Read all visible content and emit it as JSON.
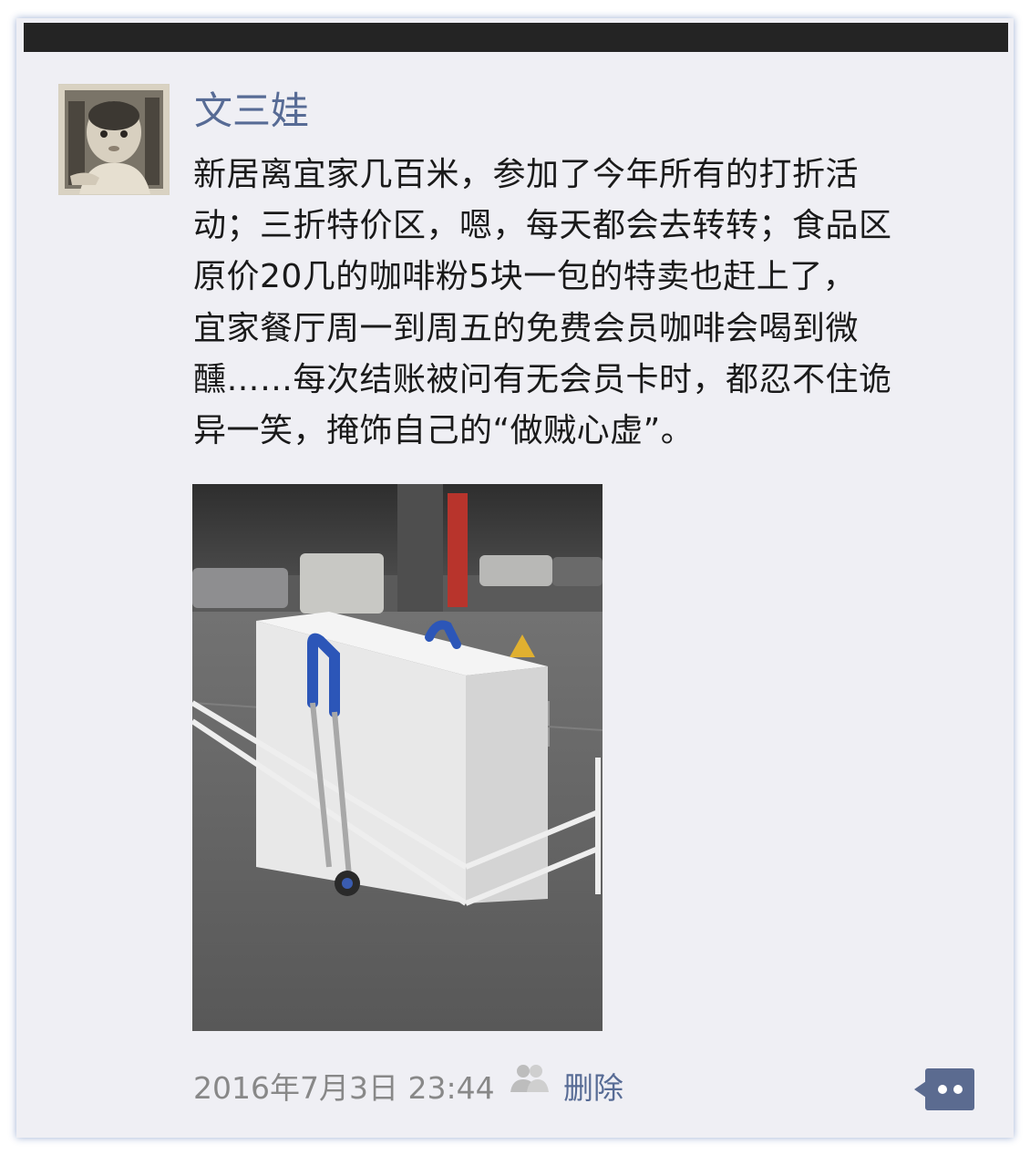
{
  "post": {
    "username": "文三娃",
    "text": "新居离宜家几百米，参加了今年所有的打折活\n动；三折特价区，嗯，每天都会去转转；食品区\n原价20几的咖啡粉5块一包的特卖也赶上了，\n宜家餐厅周一到周五的免费会员咖啡会喝到微\n醺……每次结账被问有无会员卡时，都忍不住诡\n异一笑，掩饰自己的“做贼心虚”。",
    "timestamp": "2016年7月3日 23:44",
    "delete_label": "删除"
  },
  "icons": {
    "avatar": "baby-photo-avatar",
    "visibility": "people-icon",
    "more": "comment-more-icon"
  },
  "colors": {
    "link": "#576b95",
    "background": "#efeff4",
    "text": "#1a1a1a",
    "meta": "#888888"
  }
}
